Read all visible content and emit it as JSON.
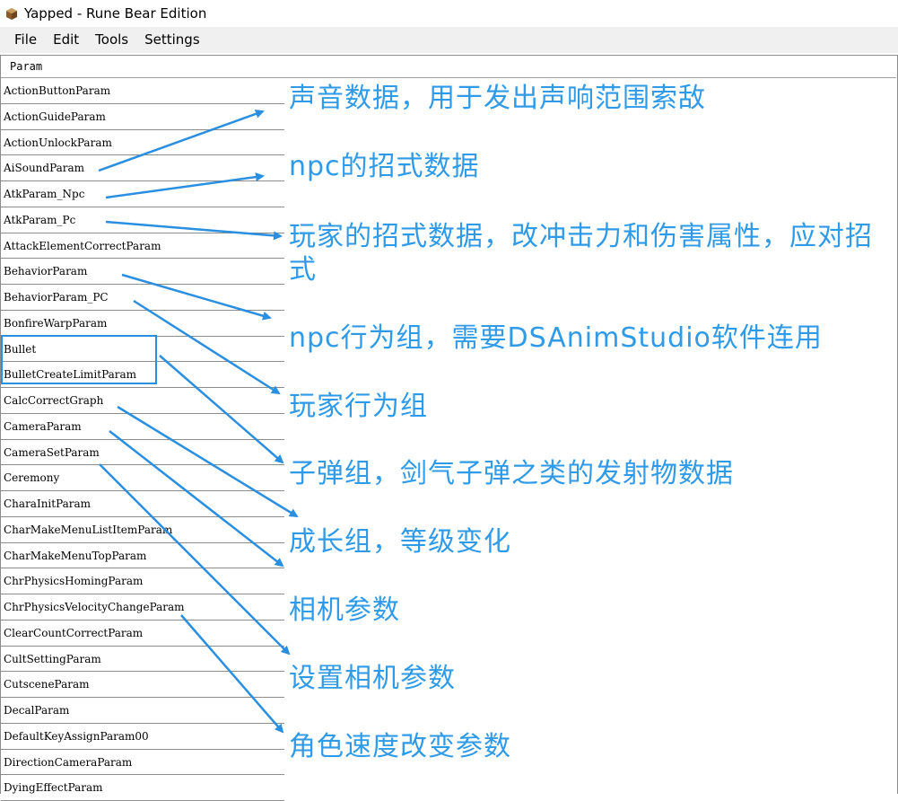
{
  "window": {
    "title": "Yapped - Rune Bear Edition"
  },
  "menu": [
    "File",
    "Edit",
    "Tools",
    "Settings"
  ],
  "grid": {
    "header": "Param",
    "rows": [
      "ActionButtonParam",
      "ActionGuideParam",
      "ActionUnlockParam",
      "AiSoundParam",
      "AtkParam_Npc",
      "AtkParam_Pc",
      "AttackElementCorrectParam",
      "BehaviorParam",
      "BehaviorParam_PC",
      "BonfireWarpParam",
      "Bullet",
      "BulletCreateLimitParam",
      "CalcCorrectGraph",
      "CameraParam",
      "CameraSetParam",
      "Ceremony",
      "CharaInitParam",
      "CharMakeMenuListItemParam",
      "CharMakeMenuTopParam",
      "ChrPhysicsHomingParam",
      "ChrPhysicsVelocityChangeParam",
      "ClearCountCorrectParam",
      "CultSettingParam",
      "CutsceneParam",
      "DecalParam",
      "DefaultKeyAssignParam00",
      "DirectionCameraParam",
      "DyingEffectParam"
    ]
  },
  "annotations": [
    "声音数据，用于发出声响范围索敌",
    "npc的招式数据",
    "玩家的招式数据，改冲击力和伤害属性，应对招式",
    "npc行为组，需要DSAnimStudio软件连用",
    "玩家行为组",
    "子弹组，剑气子弹之类的发射物数据",
    "成长组，等级变化",
    "相机参数",
    "设置相机参数",
    "角色速度改变参数"
  ],
  "colors": {
    "annotation": "#2e9ae8",
    "highlight": "#2a8fe0"
  }
}
